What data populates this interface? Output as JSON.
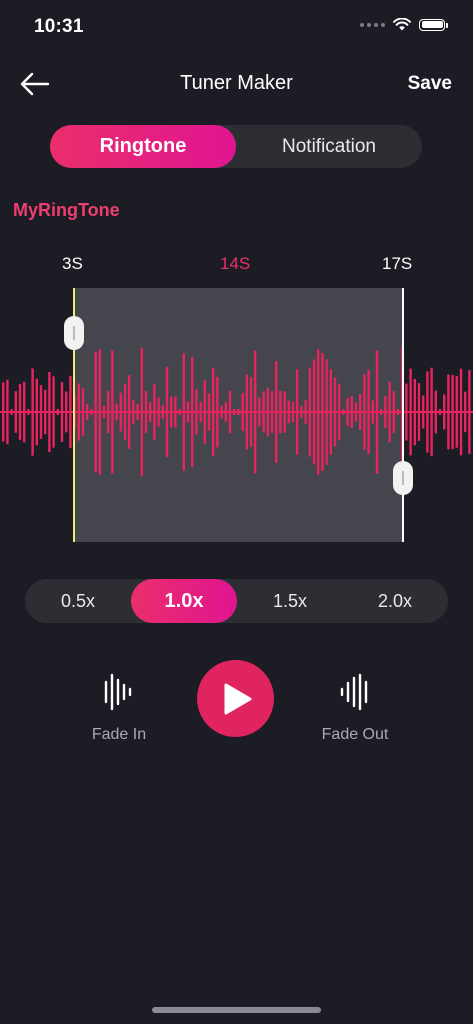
{
  "status": {
    "time": "10:31"
  },
  "header": {
    "title": "Tuner Maker",
    "save_label": "Save"
  },
  "tabs": {
    "ringtone": "Ringtone",
    "notification": "Notification",
    "selected": "Ringtone"
  },
  "tone_name": "MyRingTone",
  "trim": {
    "start_label": "3S",
    "duration_label": "14S",
    "end_label": "17S"
  },
  "speed": {
    "options": [
      "0.5x",
      "1.0x",
      "1.5x",
      "2.0x"
    ],
    "selected": "1.0x"
  },
  "controls": {
    "fade_in": "Fade In",
    "fade_out": "Fade Out"
  },
  "colors": {
    "accent": "#e8245f",
    "accent_gradient_end": "#e01591",
    "background": "#1c1c24",
    "selection": "#44454d",
    "start_handle_line": "#f5e87a"
  }
}
